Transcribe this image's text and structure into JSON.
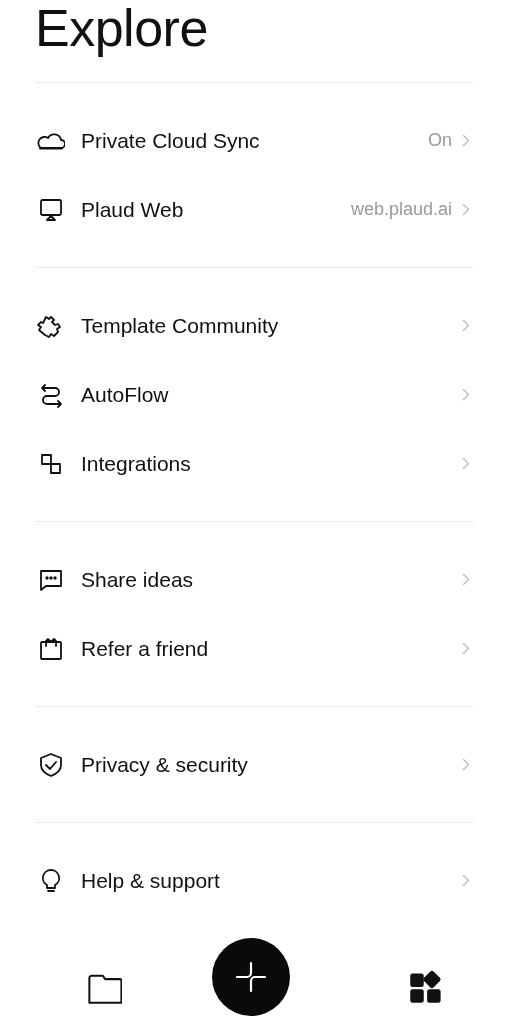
{
  "title": "Explore",
  "sections": [
    {
      "items": [
        {
          "label": "Private Cloud Sync",
          "value": "On"
        },
        {
          "label": "Plaud Web",
          "value": "web.plaud.ai"
        }
      ]
    },
    {
      "items": [
        {
          "label": "Template Community"
        },
        {
          "label": "AutoFlow"
        },
        {
          "label": "Integrations"
        }
      ]
    },
    {
      "items": [
        {
          "label": "Share ideas"
        },
        {
          "label": "Refer a friend"
        }
      ]
    },
    {
      "items": [
        {
          "label": "Privacy & security"
        }
      ]
    },
    {
      "items": [
        {
          "label": "Help & support"
        }
      ]
    }
  ],
  "bottom_nav": [
    {
      "kind": "files",
      "selected": false
    },
    {
      "kind": "add"
    },
    {
      "kind": "apps",
      "selected": true
    }
  ]
}
